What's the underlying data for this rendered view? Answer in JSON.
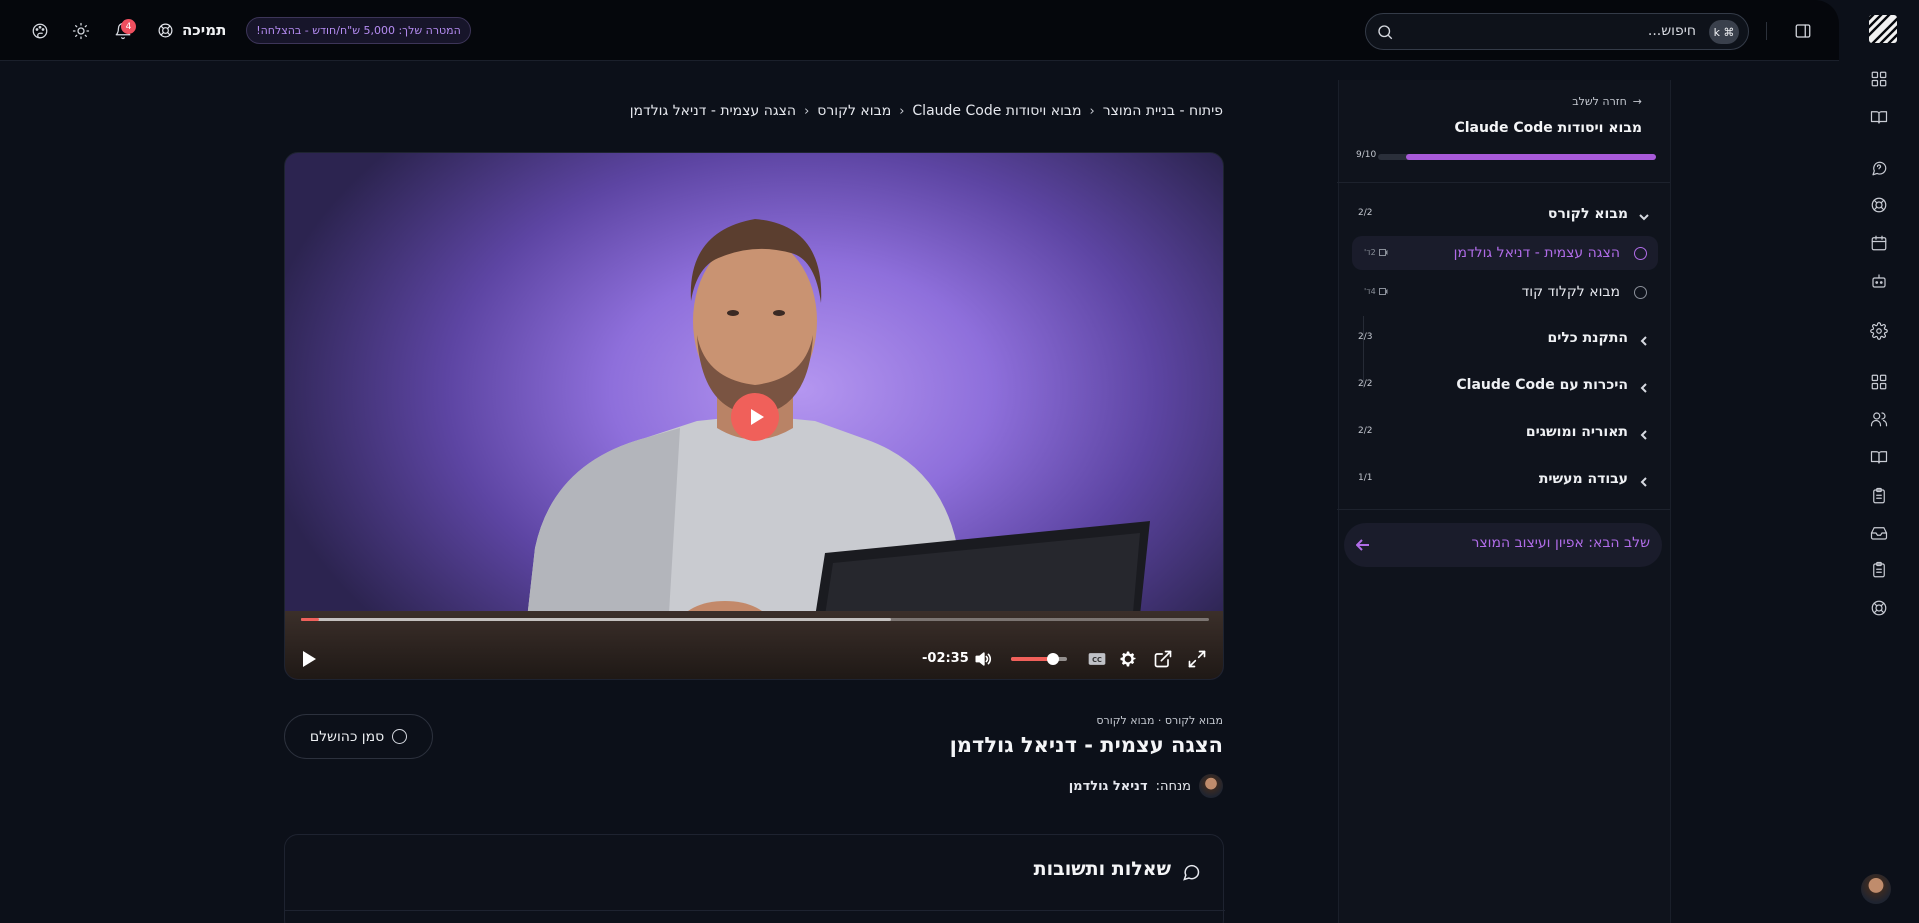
{
  "topbar": {
    "support_label": "תמיכה",
    "notification_count": "4",
    "goal_text": "המטרה שלך: 5,000 ש\"ח/חודש - בהצלחה!",
    "search": {
      "placeholder": "חיפוש...",
      "shortcut": "⌘ k"
    }
  },
  "sidebar": {
    "back_label": "חזרה לשלב",
    "course_title": "מבוא ויסודות Claude Code",
    "progress_text": "9/10",
    "progress_fraction": 0.9,
    "sections": [
      {
        "label": "מבוא לקורס",
        "count": "2/2",
        "expanded": true,
        "lessons": [
          {
            "title": "הצגה עצמית - דניאל גולדמן",
            "duration": "2ד'",
            "active": true
          },
          {
            "title": "מבוא לקלוד קוד",
            "duration": "4ד'",
            "active": false
          }
        ]
      },
      {
        "label": "התקנת כלים",
        "count": "2/3"
      },
      {
        "label": "היכרות עם Claude Code",
        "count": "2/2"
      },
      {
        "label": "תאוריה ומושגים",
        "count": "2/2"
      },
      {
        "label": "עבודה מעשית",
        "count": "1/1"
      }
    ],
    "next_step_label": "שלב הבא: אפיון ועיצוב המוצר"
  },
  "breadcrumb": [
    "פיתוח - בניית המוצר",
    "מבוא ויסודות Claude Code",
    "מבוא לקורס",
    "הצגה עצמית - דניאל גולדמן"
  ],
  "player": {
    "time_remaining": "-02:35",
    "played_fraction": 0.02,
    "buffered_fraction": 0.65,
    "volume_fraction": 0.75
  },
  "lesson": {
    "meta": "מבוא לקורס · מבוא לקורס",
    "title": "הצגה עצמית - דניאל גולדמן",
    "instructor_prefix": "מנחה:",
    "instructor_name": "דניאל גולדמן",
    "mark_complete_label": "סמן כהושלם"
  },
  "qa": {
    "title": "שאלות ותשובות"
  },
  "colors": {
    "accent": "#a85ad9",
    "player_accent": "#f0605a",
    "background": "#0c1019"
  }
}
